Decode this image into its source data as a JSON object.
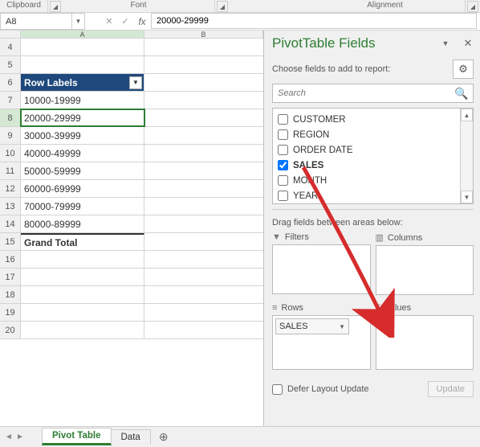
{
  "ribbon": {
    "group1": "Clipboard",
    "group2": "Font",
    "group3": "Alignment"
  },
  "namebox": {
    "ref": "A8"
  },
  "formula_bar": {
    "fx": "fx",
    "value": "20000-29999"
  },
  "columns": [
    "A",
    "B"
  ],
  "rows": [
    {
      "n": 4,
      "a": ""
    },
    {
      "n": 5,
      "a": ""
    },
    {
      "n": 6,
      "a": "Row Labels",
      "is_header": true
    },
    {
      "n": 7,
      "a": "10000-19999"
    },
    {
      "n": 8,
      "a": "20000-29999",
      "selected": true
    },
    {
      "n": 9,
      "a": "30000-39999"
    },
    {
      "n": 10,
      "a": "40000-49999"
    },
    {
      "n": 11,
      "a": "50000-59999"
    },
    {
      "n": 12,
      "a": "60000-69999"
    },
    {
      "n": 13,
      "a": "70000-79999"
    },
    {
      "n": 14,
      "a": "80000-89999"
    },
    {
      "n": 15,
      "a": "Grand Total",
      "is_total": true
    },
    {
      "n": 16,
      "a": ""
    },
    {
      "n": 17,
      "a": ""
    },
    {
      "n": 18,
      "a": ""
    },
    {
      "n": 19,
      "a": ""
    },
    {
      "n": 20,
      "a": ""
    }
  ],
  "pivot_pane": {
    "title": "PivotTable Fields",
    "choose_label": "Choose fields to add to report:",
    "search_placeholder": "Search",
    "fields": [
      {
        "name": "CUSTOMER",
        "checked": false
      },
      {
        "name": "REGION",
        "checked": false
      },
      {
        "name": "ORDER DATE",
        "checked": false
      },
      {
        "name": "SALES",
        "checked": true
      },
      {
        "name": "MONTH",
        "checked": false
      },
      {
        "name": "YEAR",
        "checked": false
      }
    ],
    "drag_label": "Drag fields between areas below:",
    "areas": {
      "filters": "Filters",
      "columns": "Columns",
      "rows": "Rows",
      "values": "Values"
    },
    "row_chip": "SALES",
    "defer_label": "Defer Layout Update",
    "update_label": "Update"
  },
  "tabs": {
    "active": "Pivot Table",
    "other": "Data"
  }
}
